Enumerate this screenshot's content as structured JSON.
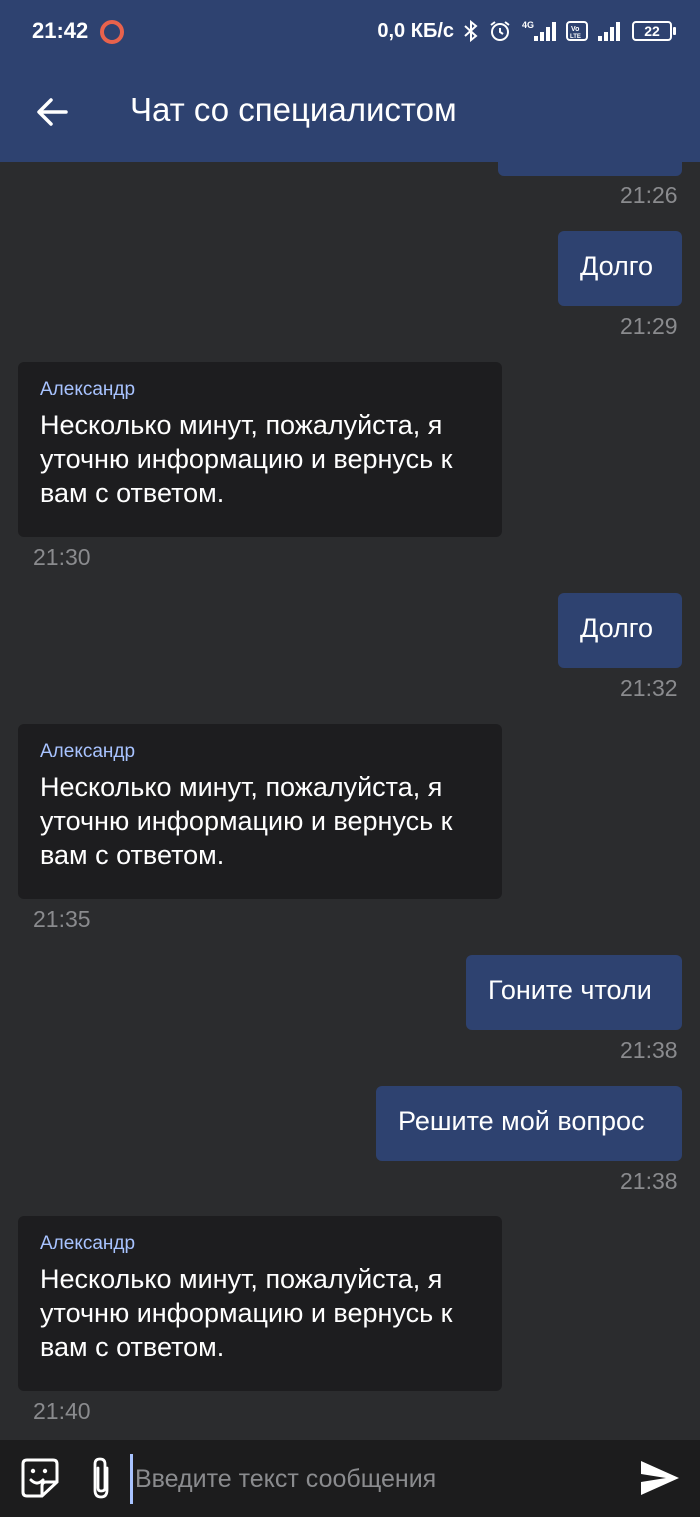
{
  "status_bar": {
    "time": "21:42",
    "network_speed": "0,0 КБ/с",
    "battery": "22",
    "icons": [
      "record-icon",
      "bluetooth-icon",
      "alarm-icon",
      "signal-4g-icon",
      "volte-icon",
      "signal-icon",
      "battery-icon"
    ]
  },
  "header": {
    "title": "Чат со специалистом",
    "back_icon": "arrow-left-icon"
  },
  "messages": [
    {
      "dir": "out",
      "text": "",
      "time": "21:26"
    },
    {
      "dir": "out",
      "text": "Долго",
      "time": "21:29"
    },
    {
      "dir": "in",
      "sender": "Александр",
      "text": "Несколько минут, пожалуйста, я уточню информацию и вернусь к вам с ответом.",
      "time": "21:30"
    },
    {
      "dir": "out",
      "text": "Долго",
      "time": "21:32"
    },
    {
      "dir": "in",
      "sender": "Александр",
      "text": "Несколько минут, пожалуйста, я уточню информацию и вернусь к вам с ответом.",
      "time": "21:35"
    },
    {
      "dir": "out",
      "text": "Гоните чтоли",
      "time": "21:38"
    },
    {
      "dir": "out",
      "text": "Решите мой вопрос",
      "time": "21:38"
    },
    {
      "dir": "in",
      "sender": "Александр",
      "text": "Несколько минут, пожалуйста, я уточню информацию и вернусь к вам с ответом.",
      "time": "21:40"
    }
  ],
  "composer": {
    "placeholder": "Введите текст сообщения",
    "value": "",
    "icons": [
      "sticker-icon",
      "paperclip-icon",
      "send-icon"
    ]
  },
  "colors": {
    "background": "#2b2c2e",
    "header": "#2e4270",
    "outgoing_bubble": "#2e4270",
    "incoming_bubble": "#1d1d1f",
    "sender_name": "#a8c3ff",
    "timestamp": "#8a8b8e"
  }
}
